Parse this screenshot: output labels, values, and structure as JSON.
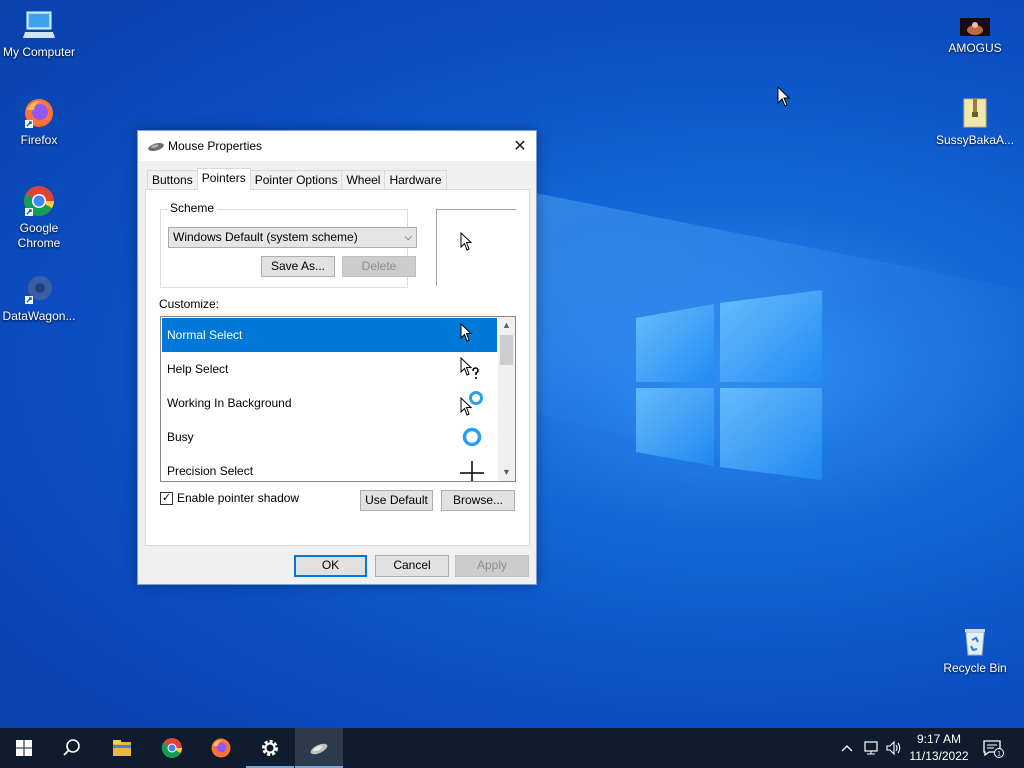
{
  "desktop": {
    "icons_left": [
      {
        "label": "My Computer"
      },
      {
        "label": "Firefox"
      },
      {
        "label": "Google Chrome"
      },
      {
        "label": "DataWagon..."
      }
    ],
    "icons_right": [
      {
        "label": "AMOGUS"
      },
      {
        "label": "SussyBakaA..."
      },
      {
        "label": "Recycle Bin"
      }
    ]
  },
  "dialog": {
    "title": "Mouse Properties",
    "close_glyph": "✕",
    "tabs": [
      {
        "label": "Buttons",
        "active": false
      },
      {
        "label": "Pointers",
        "active": true
      },
      {
        "label": "Pointer Options",
        "active": false
      },
      {
        "label": "Wheel",
        "active": false
      },
      {
        "label": "Hardware",
        "active": false
      }
    ],
    "scheme": {
      "label": "Scheme",
      "selected": "Windows Default (system scheme)",
      "save_as": "Save As...",
      "delete": "Delete"
    },
    "customize_label": "Customize:",
    "pointers": [
      {
        "name": "Normal Select",
        "icon": "arrow-cursor-icon",
        "selected": true
      },
      {
        "name": "Help Select",
        "icon": "help-cursor-icon",
        "selected": false
      },
      {
        "name": "Working In Background",
        "icon": "working-cursor-icon",
        "selected": false
      },
      {
        "name": "Busy",
        "icon": "busy-cursor-icon",
        "selected": false
      },
      {
        "name": "Precision Select",
        "icon": "crosshair-cursor-icon",
        "selected": false
      }
    ],
    "enable_shadow": {
      "label": "Enable pointer shadow",
      "checked": true
    },
    "use_default": "Use Default",
    "browse": "Browse...",
    "ok": "OK",
    "cancel": "Cancel",
    "apply": "Apply"
  },
  "taskbar": {
    "time": "9:17 AM",
    "date": "11/13/2022",
    "notification_count": "1"
  },
  "colors": {
    "accent": "#0078d7",
    "taskbar": "#0f1c2e"
  }
}
